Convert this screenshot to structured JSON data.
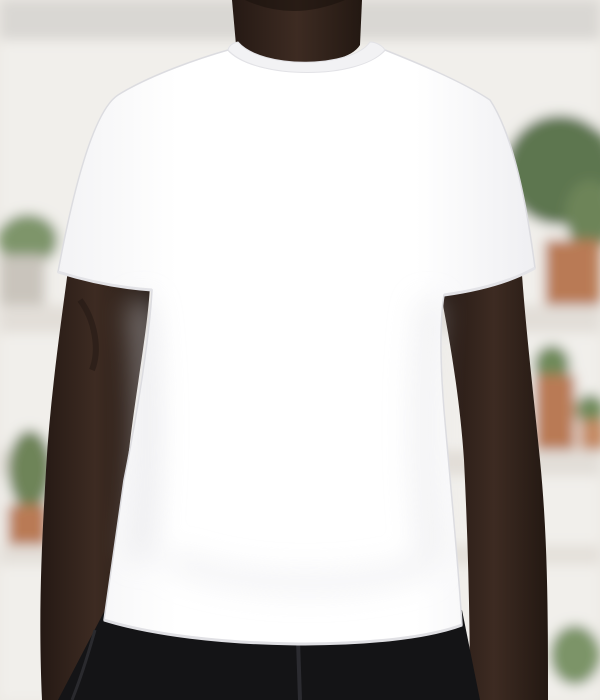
{
  "photo": {
    "subject": "model-wearing-white-tshirt",
    "colors": {
      "background": "#ece9e4",
      "wall": "#f1efeb",
      "shelf": "#e2ded8",
      "plant": "#6f8a5a",
      "pot": "#b97a55",
      "skin": "#3b2a22",
      "skin_shadow": "#271b16",
      "shirt": "#ffffff",
      "shirt_shadow": "#e9e9ec",
      "pants": "#141416"
    }
  }
}
